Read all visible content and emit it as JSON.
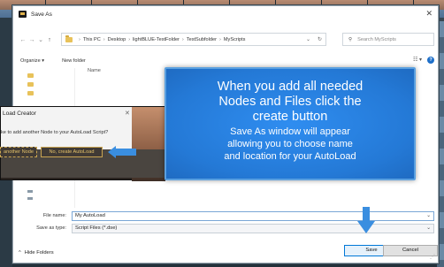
{
  "window": {
    "title": "Save As"
  },
  "nav": {
    "breadcrumb": [
      "This PC",
      "Desktop",
      "lightBLUE-TestFolder",
      "TestSubfolder",
      "MyScripts"
    ],
    "search_placeholder": "Search MyScripts"
  },
  "toolbar": {
    "organize_label": "Organize ▾",
    "new_folder_label": "New folder"
  },
  "filelist": {
    "name_header": "Name"
  },
  "bottom": {
    "file_name_label": "File name:",
    "file_name_value": "My AutoLoad",
    "save_type_label": "Save as type:",
    "save_type_value": "Script Files (*.dse)",
    "hide_folders_label": "Hide Folders",
    "save_button": "Save",
    "cancel_button": "Cancel"
  },
  "popup": {
    "title": "Load Creator",
    "question": "ke to add another Node to your AutoLoad Script?",
    "another_node_label": "another Node",
    "create_label": "No, create AutoLoad"
  },
  "tooltip": {
    "line1": "When you add all needed",
    "line2": "Nodes and Files click the",
    "line3": "create button",
    "line4": "Save As window will appear",
    "line5": "allowing you to choose name",
    "line6": "and location for your AutoLoad"
  },
  "colors": {
    "accent": "#0078d7",
    "tooltip_bg": "#2479d6",
    "popup_button_text": "#e6c36a"
  }
}
